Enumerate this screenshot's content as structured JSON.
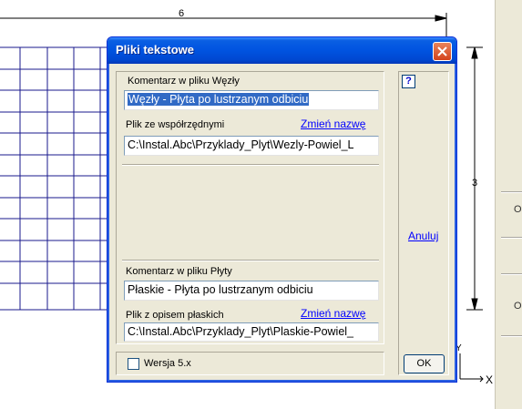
{
  "drawing": {
    "dimension_top": "6",
    "dimension_right": "3",
    "axis_x": "X",
    "axis_y": "Y"
  },
  "right_panel": {
    "labels": [
      "O",
      "O"
    ]
  },
  "dialog": {
    "title": "Pliki tekstowe",
    "nodes_comment_label": "Komentarz w pliku Węzły",
    "nodes_comment_value": "Węzły - Płyta po lustrzanym odbiciu",
    "coords_file_label": "Plik ze współrzędnymi",
    "rename_link_1": "Zmień nazwę",
    "coords_file_value": "C:\\Instal.Abc\\Przyklady_Plyt\\Wezly-Powiel_L",
    "plates_comment_label": "Komentarz w pliku Płyty",
    "plates_comment_value": "Płaskie - Płyta po lustrzanym odbiciu",
    "flat_file_label": "Plik z opisem płaskich",
    "rename_link_2": "Zmień nazwę",
    "flat_file_value": "C:\\Instal.Abc\\Przyklady_Plyt\\Plaskie-Powiel_",
    "version_checkbox_label": "Wersja 5.x",
    "version_checked": false,
    "help_label": "?",
    "cancel_label": "Anuluj",
    "ok_label": "OK"
  },
  "colors": {
    "grid": "#1a1a8c",
    "titlebar": "#0053e0",
    "link": "#0000ff"
  }
}
